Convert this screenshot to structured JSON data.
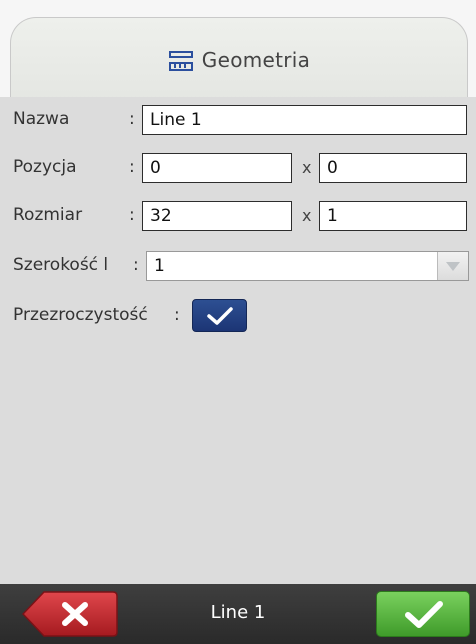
{
  "tab": {
    "label": "Geometria",
    "icon": "ruler-icon"
  },
  "fields": {
    "name": {
      "label": "Nazwa",
      "colon": ":",
      "value": "Line 1"
    },
    "position": {
      "label": "Pozycja",
      "colon": ":",
      "x_value": "0",
      "separator": "x",
      "y_value": "0"
    },
    "size": {
      "label": "Rozmiar",
      "colon": ":",
      "w_value": "32",
      "separator": "x",
      "h_value": "1"
    },
    "line_width": {
      "label": "Szerokość l",
      "colon": ":",
      "value": "1"
    },
    "transparency": {
      "label": "Przezroczystość",
      "colon": ":",
      "checked": true
    }
  },
  "footer": {
    "title": "Line 1",
    "cancel_icon": "close-icon",
    "ok_icon": "check-icon"
  },
  "colors": {
    "checkbox": "#1f3a7c",
    "cancel": "#c8262c",
    "ok": "#4cae33",
    "footer_bg": "#333333"
  }
}
